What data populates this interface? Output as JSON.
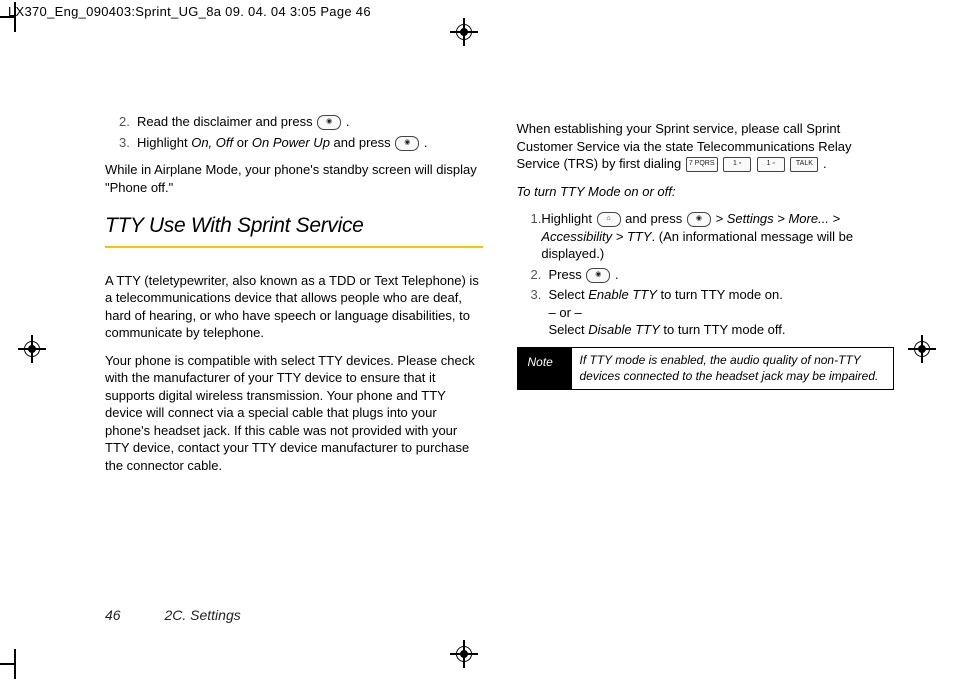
{
  "header": "LX370_Eng_090403:Sprint_UG_8a  09. 04. 04      3:05   Page 46",
  "left": {
    "item2_pre": "Read the disclaimer and press ",
    "item3_pre": "Highlight ",
    "item3_opts": "On, Off ",
    "item3_or": "or ",
    "item3_opt2": "On Power Up ",
    "item3_post": " and press ",
    "airplane": "While in Airplane Mode, your phone's standby screen will display \"Phone off.\"",
    "heading": "TTY Use With Sprint Service",
    "p1": "A TTY (teletypewriter, also known as a TDD or Text Telephone) is a telecommunications device that allows people who are deaf, hard of hearing, or who have speech or language disabilities, to communicate by telephone.",
    "p2": "Your phone is compatible with select TTY devices. Please check with the manufacturer of your TTY device to ensure that it supports digital wireless transmission. Your phone and TTY device will connect via a special cable that plugs into your phone's headset jack. If this cable was not provided with your TTY device, contact your TTY device manufacturer to purchase the connector cable."
  },
  "right": {
    "intro_a": "When establishing your Sprint service, please call Sprint Customer Service via the state Telecommunications Relay Service (TRS) by first dialing ",
    "intro_b": " .",
    "proc_title": "To turn TTY Mode on or off:",
    "s1_a": "Highlight ",
    "s1_b": " and press ",
    "s1_path": " > Settings > More... > Accessibility > TTY",
    "s1_c": ".  (An informational message will be displayed.)",
    "s2": "Press ",
    "s3_a": "Select ",
    "s3_enable": "Enable TTY",
    "s3_b": " to turn TTY mode on.",
    "s3_or": "– or –",
    "s3_c": "Select ",
    "s3_disable": "Disable TTY",
    "s3_d": " to turn TTY mode off.",
    "note_label": "Note",
    "note_text": "If TTY mode is enabled, the audio quality of non-TTY devices connected to the headset jack may be impaired."
  },
  "keys": {
    "menu": "⌂",
    "ok": "◉",
    "seven": "7 PQRS",
    "one": "1 ▫",
    "talk": "TALK",
    "home": "⌂"
  },
  "footer": {
    "page": "46",
    "section": "2C. Settings"
  }
}
